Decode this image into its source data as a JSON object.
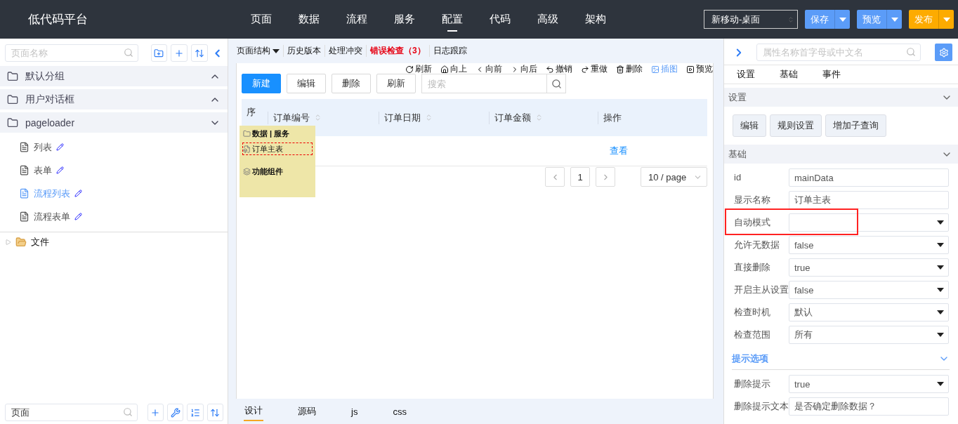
{
  "header": {
    "logo": "低代码平台",
    "nav": [
      {
        "label": "页面",
        "selected": false
      },
      {
        "label": "数据",
        "selected": false
      },
      {
        "label": "流程",
        "selected": false
      },
      {
        "label": "服务",
        "selected": false
      },
      {
        "label": "配置",
        "selected": true
      },
      {
        "label": "代码",
        "selected": false
      },
      {
        "label": "高级",
        "selected": false
      },
      {
        "label": "架构",
        "selected": false
      }
    ],
    "device_select": {
      "value": "新移动-桌面"
    },
    "buttons": [
      {
        "label": "保存",
        "color": "#5b9cf8"
      },
      {
        "label": "预览",
        "color": "#5b9cf8"
      },
      {
        "label": "发布",
        "color": "#fdab00"
      }
    ]
  },
  "sidebar": {
    "search": {
      "placeholder": "页面名称"
    },
    "groups": [
      {
        "label": "默认分组",
        "expanded": false
      },
      {
        "label": "用户对话框",
        "expanded": false
      },
      {
        "label": "pageloader",
        "expanded": true,
        "children": [
          {
            "label": "列表",
            "selected": false
          },
          {
            "label": "表单",
            "selected": false
          },
          {
            "label": "流程列表",
            "selected": true
          },
          {
            "label": "流程表单",
            "selected": false
          }
        ]
      }
    ],
    "files": {
      "label": "文件",
      "expanded": false
    },
    "bottom_search": {
      "value": "页面"
    }
  },
  "editor": {
    "menu": [
      {
        "label": "页面结构",
        "kind": "dropdown"
      },
      {
        "label": "历史版本",
        "kind": "plain"
      },
      {
        "label": "处理冲突",
        "kind": "plain"
      },
      {
        "label": "错误检查（3）",
        "kind": "error"
      },
      {
        "label": "日志跟踪",
        "kind": "plain"
      }
    ],
    "actions": [
      {
        "label": "刷新",
        "selected": false
      },
      {
        "label": "向上",
        "selected": false
      },
      {
        "label": "向前",
        "selected": false
      },
      {
        "label": "向后",
        "selected": false
      },
      {
        "label": "撤销",
        "selected": false
      },
      {
        "label": "重做",
        "selected": false
      },
      {
        "label": "删除",
        "selected": false
      },
      {
        "label": "插图",
        "selected": true
      },
      {
        "label": "预览",
        "selected": false
      }
    ],
    "canvas": {
      "buttons": [
        {
          "label": "新建",
          "primary": true
        },
        {
          "label": "编辑",
          "primary": false
        },
        {
          "label": "删除",
          "primary": false
        },
        {
          "label": "刷新",
          "primary": false
        }
      ],
      "search": {
        "placeholder": "搜索"
      },
      "table": {
        "columns": [
          {
            "label": "序",
            "sortable": false
          },
          {
            "label": "订单编号",
            "sortable": true
          },
          {
            "label": "订单日期",
            "sortable": true
          },
          {
            "label": "订单金额",
            "sortable": true
          },
          {
            "label": "操作",
            "sortable": false
          }
        ],
        "rows": [
          {
            "action": "查看"
          }
        ]
      },
      "pagination": {
        "page": "1",
        "page_size": "10 / page"
      }
    },
    "component_popup": {
      "items": [
        {
          "label": "数据 | 服务",
          "kind": "folder",
          "selected": false
        },
        {
          "label": "订单主表",
          "kind": "data",
          "selected": true
        },
        {
          "label": "功能组件",
          "kind": "stack",
          "selected": false
        }
      ]
    },
    "tabs": [
      {
        "label": "设计",
        "selected": true
      },
      {
        "label": "源码",
        "selected": false
      },
      {
        "label": "js",
        "selected": false
      },
      {
        "label": "css",
        "selected": false
      }
    ]
  },
  "properties": {
    "search": {
      "placeholder": "属性名称首字母或中文名"
    },
    "tabs": [
      "设置",
      "基础",
      "事件"
    ],
    "sections": [
      {
        "title": "设置",
        "kind": "panel",
        "expanded": true,
        "buttons": [
          "编辑",
          "规则设置",
          "增加子查询"
        ]
      },
      {
        "title": "基础",
        "kind": "panel",
        "expanded": true,
        "rows": [
          {
            "label": "id",
            "kind": "input",
            "value": "mainData",
            "highlighted": false
          },
          {
            "label": "显示名称",
            "kind": "input",
            "value": "订单主表",
            "highlighted": false
          },
          {
            "label": "自动模式",
            "kind": "select",
            "highlighted": true
          },
          {
            "label": "允许无数据",
            "kind": "select",
            "value": "false",
            "highlighted": false
          },
          {
            "label": "直接删除",
            "kind": "select",
            "value": "true",
            "highlighted": false
          },
          {
            "label": "开启主从设置",
            "kind": "select",
            "value": "false",
            "highlighted": false
          },
          {
            "label": "检查时机",
            "kind": "select",
            "value": "默认",
            "highlighted": false
          },
          {
            "label": "检查范围",
            "kind": "select",
            "value": "所有",
            "highlighted": false
          }
        ]
      },
      {
        "title": "提示选项",
        "kind": "link",
        "expanded": true,
        "rows": [
          {
            "label": "删除提示",
            "kind": "select",
            "value": "true",
            "highlighted": false
          },
          {
            "label": "删除提示文本",
            "kind": "input",
            "value": "是否确定删除数据？",
            "highlighted": false
          }
        ]
      }
    ]
  }
}
